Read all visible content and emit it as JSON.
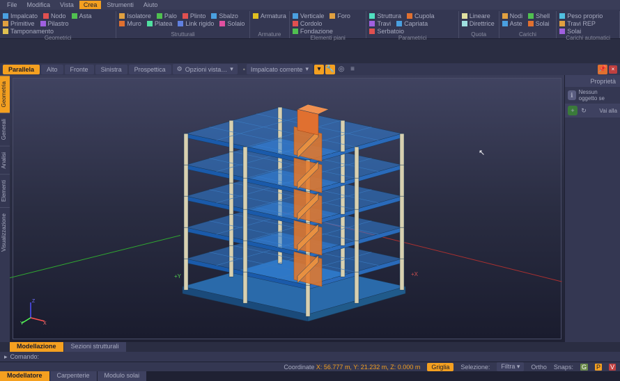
{
  "menubar": [
    "File",
    "Modifica",
    "Vista",
    "Crea",
    "Strumenti",
    "Aiuto"
  ],
  "menubar_active": 3,
  "ribbon_groups": [
    {
      "label": "Geometrici",
      "items": [
        {
          "icon": "#4aa0e0",
          "text": "Impalcato"
        },
        {
          "icon": "#e05050",
          "text": "Nodo"
        },
        {
          "icon": "#50c050",
          "text": "Asta"
        },
        {
          "icon": "#e0a040",
          "text": "Primitive"
        },
        {
          "icon": "#a060e0",
          "text": "Pilastro"
        },
        {
          "icon": "#e0c050",
          "text": "Tamponamento"
        }
      ]
    },
    {
      "label": "Strutturali",
      "items": [
        {
          "icon": "#e0a040",
          "text": "Isolatore"
        },
        {
          "icon": "#50c050",
          "text": "Palo"
        },
        {
          "icon": "#e05050",
          "text": "Plinto"
        },
        {
          "icon": "#4aa0e0",
          "text": "Sbalzo"
        },
        {
          "icon": "#e07030",
          "text": "Muro"
        },
        {
          "icon": "#50e0a0",
          "text": "Platea"
        },
        {
          "icon": "#6080e0",
          "text": "Link rigido"
        },
        {
          "icon": "#e050a0",
          "text": "Solaio"
        }
      ]
    },
    {
      "label": "Armature",
      "items": [
        {
          "icon": "#e0c020",
          "text": "Armatura"
        }
      ]
    },
    {
      "label": "Elementi piani",
      "items": [
        {
          "icon": "#4aa0e0",
          "text": "Verticale"
        },
        {
          "icon": "#e0a040",
          "text": "Foro"
        },
        {
          "icon": "#e05050",
          "text": "Cordolo"
        },
        {
          "icon": "#50c050",
          "text": "Fondazione"
        }
      ]
    },
    {
      "label": "Parametrici",
      "items": [
        {
          "icon": "#50e0c0",
          "text": "Struttura"
        },
        {
          "icon": "#e07030",
          "text": "Cupola"
        },
        {
          "icon": "#a060e0",
          "text": "Travi"
        },
        {
          "icon": "#4aa0e0",
          "text": "Capriata"
        },
        {
          "icon": "#e05050",
          "text": "Serbatoio"
        }
      ]
    },
    {
      "label": "Quota",
      "items": [
        {
          "icon": "#e0e0a0",
          "text": "Lineare"
        },
        {
          "icon": "#a0e0e0",
          "text": "Direttrice"
        }
      ]
    },
    {
      "label": "Carichi",
      "items": [
        {
          "icon": "#e0a040",
          "text": "Nodi"
        },
        {
          "icon": "#50c050",
          "text": "Shell"
        },
        {
          "icon": "#4aa0e0",
          "text": "Aste"
        },
        {
          "icon": "#e07030",
          "text": "Solai"
        }
      ]
    },
    {
      "label": "Carichi automatici",
      "items": [
        {
          "icon": "#50c0e0",
          "text": "Peso proprio"
        },
        {
          "icon": "#e0a040",
          "text": "Travi REP"
        },
        {
          "icon": "#a060e0",
          "text": "Solai"
        }
      ]
    }
  ],
  "viewbar": {
    "tabs": [
      "Parallela",
      "Alto",
      "Fronte",
      "Sinistra",
      "Prospettica"
    ],
    "active": 0,
    "options_btn": "Opzioni vista…",
    "level_dropdown": "Impalcato corrente"
  },
  "sidetabs": [
    "Geometria",
    "Generali",
    "Analisi",
    "Elementi",
    "Visualizzazione"
  ],
  "sidetab_active": 0,
  "bottom_tabs": [
    "Modellazione",
    "Sezioni strutturali"
  ],
  "bottom_tab_active": 0,
  "doc_tabs": [
    "Modellatore",
    "Carpenterie",
    "Modulo solai"
  ],
  "doc_tab_active": 0,
  "props": {
    "title": "Proprietà",
    "none": "Nessun oggetto se",
    "goto": "Vai alla"
  },
  "cmd_label": "Comando:",
  "status": {
    "coord_label": "Coordinate ",
    "coord_value": "X: 56.777 m, Y: 21.232 m, Z: 0.000 m",
    "griglia": "Griglia",
    "selezione": "Selezione:",
    "filtra": "Filtra",
    "ortho": "Ortho",
    "snaps": "Snaps:"
  },
  "axis": {
    "x": "X",
    "y": "Y",
    "z": "Z"
  }
}
